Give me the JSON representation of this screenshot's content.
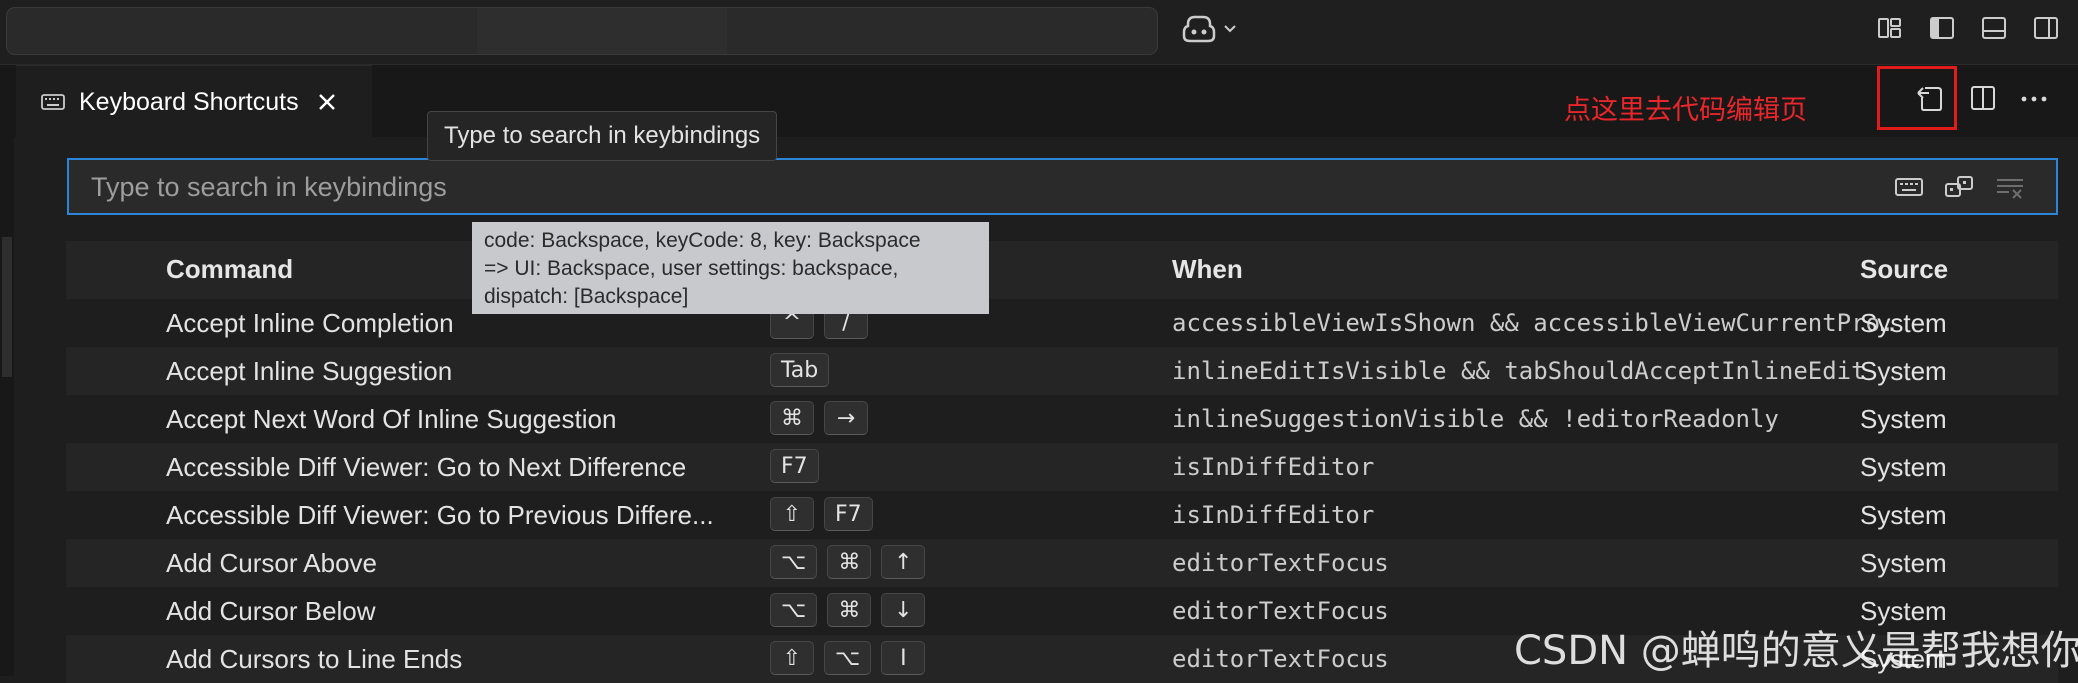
{
  "titlebar": {
    "command_center_text": "",
    "icons": [
      "copilot-icon",
      "chevron-down-icon",
      "customize-layout-icon",
      "toggle-primary-sidebar-icon",
      "toggle-panel-icon",
      "toggle-secondary-sidebar-icon"
    ]
  },
  "tab": {
    "label": "Keyboard Shortcuts",
    "icon": "keyboard-icon"
  },
  "annotation": {
    "text": "点这里去代码编辑页"
  },
  "search": {
    "placeholder": "Type to search in keybindings",
    "value": ""
  },
  "tooltip": {
    "text": "Type to search in keybindings"
  },
  "key_tooltip": {
    "lines": [
      "code: Backspace, keyCode: 8, key: Backspace",
      "=> UI: Backspace, user settings: backspace,",
      "dispatch: [Backspace]"
    ]
  },
  "table": {
    "headers": {
      "command": "Command",
      "keybinding": "",
      "when": "When",
      "source": "Source"
    },
    "rows": [
      {
        "command": "Accept Inline Completion",
        "keys": [
          "^",
          "/"
        ],
        "when": "accessibleViewIsShown && accessibleViewCurrentProviderId == 'inlineCompletions'",
        "source": "System"
      },
      {
        "command": "Accept Inline Suggestion",
        "keys": [
          "Tab"
        ],
        "when": "inlineEditIsVisible && tabShouldAcceptInlineEdit",
        "source": "System"
      },
      {
        "command": "Accept Next Word Of Inline Suggestion",
        "keys": [
          "⌘",
          "→"
        ],
        "when": "inlineSuggestionVisible && !editorReadonly",
        "source": "System"
      },
      {
        "command": "Accessible Diff Viewer: Go to Next Difference",
        "keys": [
          "F7"
        ],
        "when": "isInDiffEditor",
        "source": "System"
      },
      {
        "command": "Accessible Diff Viewer: Go to Previous Differe...",
        "keys": [
          "⇧",
          "F7"
        ],
        "when": "isInDiffEditor",
        "source": "System"
      },
      {
        "command": "Add Cursor Above",
        "keys": [
          "⌥",
          "⌘",
          "↑"
        ],
        "when": "editorTextFocus",
        "source": "System"
      },
      {
        "command": "Add Cursor Below",
        "keys": [
          "⌥",
          "⌘",
          "↓"
        ],
        "when": "editorTextFocus",
        "source": "System"
      },
      {
        "command": "Add Cursors to Line Ends",
        "keys": [
          "⇧",
          "⌥",
          "I"
        ],
        "when": "editorTextFocus",
        "source": "System"
      }
    ]
  },
  "watermark": "CSDN @蝉鸣的意义是帮我想你",
  "colors": {
    "accent": "#2b86d9",
    "annotation_red": "#e21b1b",
    "background": "#1e1e1e"
  }
}
